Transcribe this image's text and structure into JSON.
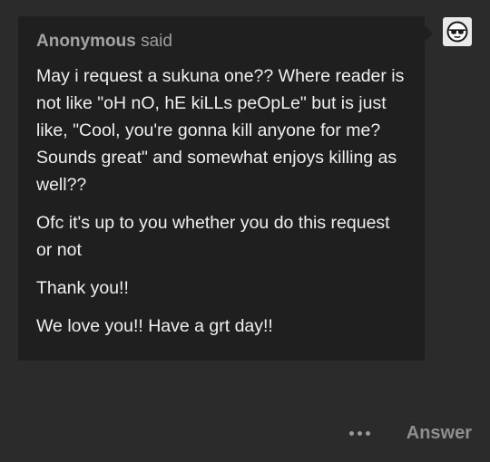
{
  "ask": {
    "asker_name": "Anonymous",
    "asker_suffix": "said",
    "paragraphs": [
      "May i request a sukuna one?? Where reader is not like \"oH nO, hE kiLLs peOpLe\" but is just like, \"Cool, you're gonna kill anyone for me? Sounds great\" and somewhat enjoys killing as well??",
      "Ofc it's up to you whether you do this request or not",
      "Thank you!!",
      "We love you!! Have a grt day!!"
    ]
  },
  "avatar": {
    "icon": "anonymous-sunglasses-icon"
  },
  "footer": {
    "more_icon": "ellipsis-icon",
    "answer_label": "Answer"
  },
  "colors": {
    "page_background": "#2b2b2b",
    "card_background": "#1f1f1f",
    "text": "#efefef",
    "muted_text": "#9e9e9e"
  }
}
